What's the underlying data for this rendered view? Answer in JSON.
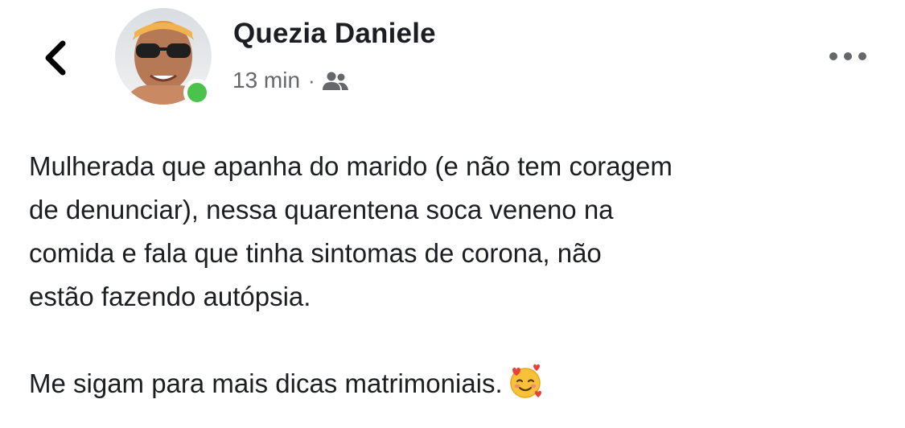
{
  "post": {
    "author_name": "Quezia Daniele",
    "timestamp": "13 min",
    "separator": "·",
    "audience_icon": "friends-icon",
    "paragraphs": [
      "Mulherada que apanha do marido (e não tem coragem\nde denunciar), nessa quarentena soca veneno na\ncomida e fala que tinha sintomas de corona, não\nestão fazendo autópsia.",
      "Me sigam para mais dicas matrimoniais."
    ],
    "emoji": "smiling-face-with-hearts-icon"
  },
  "icons": {
    "back": "chevron-left-icon",
    "more": "more-options-icon"
  },
  "colors": {
    "name_text": "#1c1e21",
    "meta_text": "#65676b",
    "online_status": "#4bc24b"
  }
}
